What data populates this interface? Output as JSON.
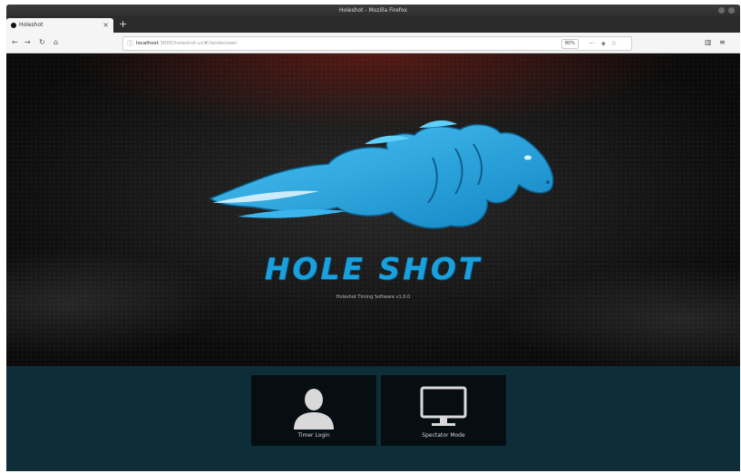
{
  "window": {
    "title": "Holeshot - Mozilla Firefox"
  },
  "tab": {
    "title": "Holeshot",
    "close_glyph": "×",
    "new_tab_glyph": "+"
  },
  "nav": {
    "back": "←",
    "forward": "→",
    "reload": "↻",
    "home": "⌂",
    "url_host": "localhost",
    "url_rest": ":3000/holeshot-ui/#/landscreen",
    "zoom": "80%",
    "more": "···",
    "library": "▥",
    "menu": "≡"
  },
  "hero": {
    "brand": "HOLE SHOT",
    "subtitle": "Holeshot Timing Software v1.0.0"
  },
  "tiles": [
    {
      "label": "Timer Login",
      "icon": "user-silhouette-icon"
    },
    {
      "label": "Spectator Mode",
      "icon": "monitor-icon"
    }
  ],
  "colors": {
    "brand_blue": "#1aa0dd",
    "footer_bg": "#0d2e38",
    "tile_bg": "#060e12"
  }
}
